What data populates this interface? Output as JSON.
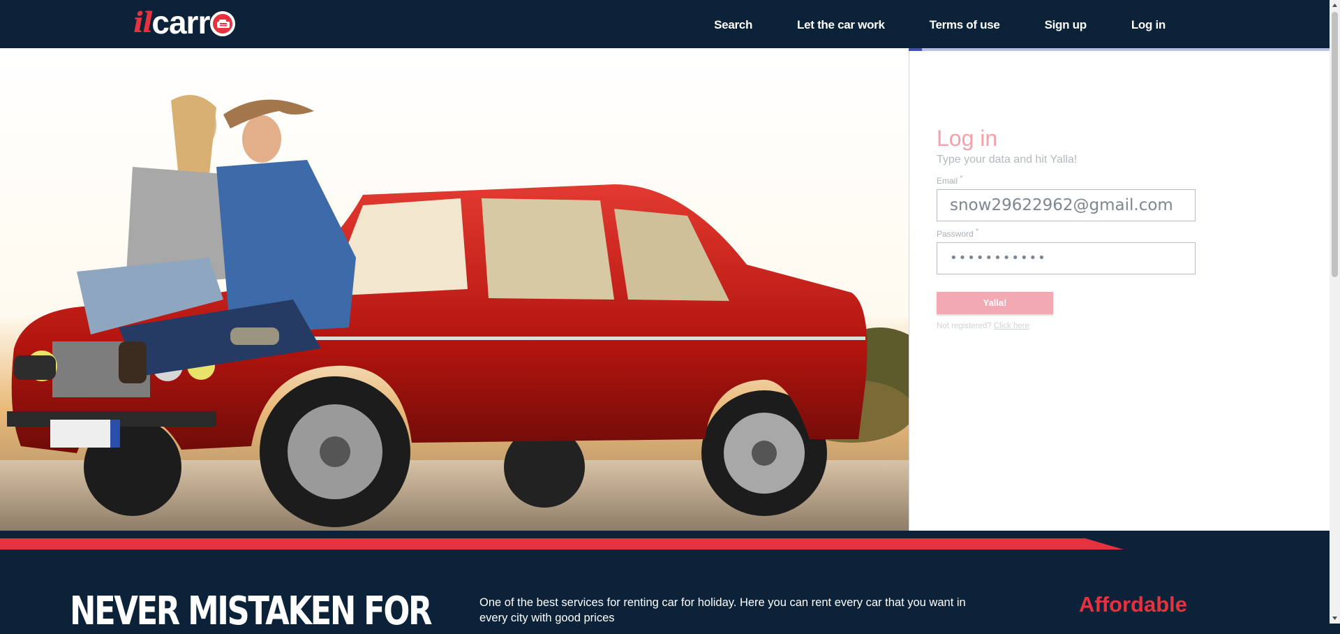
{
  "header": {
    "logo": {
      "prefix": "il",
      "main": "carr"
    },
    "nav": [
      {
        "label": "Search"
      },
      {
        "label": "Let the car work"
      },
      {
        "label": "Terms of use"
      },
      {
        "label": "Sign up"
      },
      {
        "label": "Log in"
      }
    ]
  },
  "login": {
    "title": "Log in",
    "subtitle": "Type your data and hit Yalla!",
    "email_label": "Email",
    "email_value": "snow29622962@gmail.com",
    "password_label": "Password",
    "password_value": "•••••••••••",
    "required_mark": "*",
    "submit_label": "Yalla!",
    "not_registered": "Not registered?",
    "click_here": "Click here"
  },
  "colors": {
    "navy": "#0b2239",
    "brand_red": "#e5323e",
    "pink": "#f3a1ab",
    "progress": "#3f51b5"
  },
  "hero": {
    "image": "couple-sitting-on-red-vintage-car"
  },
  "bottom": {
    "headline": "NEVER MISTAKEN FOR",
    "description": "One of the best services for renting car for holiday. Here you can rent every car that you want in every city with good prices",
    "feature": "Affordable"
  }
}
